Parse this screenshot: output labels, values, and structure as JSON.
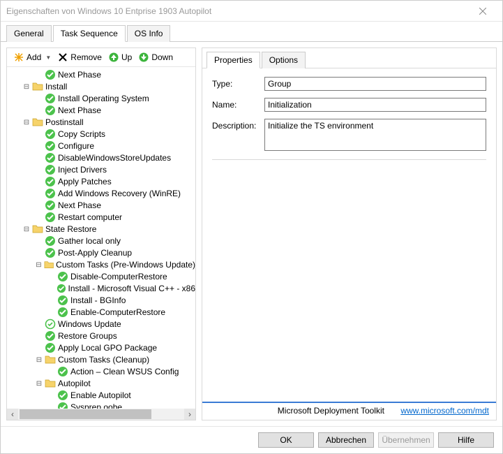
{
  "window": {
    "title": "Eigenschaften von Windows 10 Entprise 1903 Autopilot"
  },
  "main_tabs": {
    "general": "General",
    "task_sequence": "Task Sequence",
    "os_info": "OS Info",
    "active": "task_sequence"
  },
  "toolbar": {
    "add": "Add",
    "remove": "Remove",
    "up": "Up",
    "down": "Down"
  },
  "tree": [
    {
      "icon": "check",
      "label": "Next Phase",
      "depth": 2
    },
    {
      "icon": "folder",
      "label": "Install",
      "depth": 1,
      "expanded": true
    },
    {
      "icon": "check",
      "label": "Install Operating System",
      "depth": 2
    },
    {
      "icon": "check",
      "label": "Next Phase",
      "depth": 2
    },
    {
      "icon": "folder",
      "label": "Postinstall",
      "depth": 1,
      "expanded": true
    },
    {
      "icon": "check",
      "label": "Copy Scripts",
      "depth": 2
    },
    {
      "icon": "check",
      "label": "Configure",
      "depth": 2
    },
    {
      "icon": "check",
      "label": "DisableWindowsStoreUpdates",
      "depth": 2
    },
    {
      "icon": "check",
      "label": "Inject Drivers",
      "depth": 2
    },
    {
      "icon": "check",
      "label": "Apply Patches",
      "depth": 2
    },
    {
      "icon": "check",
      "label": "Add Windows Recovery (WinRE)",
      "depth": 2
    },
    {
      "icon": "check",
      "label": "Next Phase",
      "depth": 2
    },
    {
      "icon": "check",
      "label": "Restart computer",
      "depth": 2
    },
    {
      "icon": "folder",
      "label": "State Restore",
      "depth": 1,
      "expanded": true
    },
    {
      "icon": "check",
      "label": "Gather local only",
      "depth": 2
    },
    {
      "icon": "check",
      "label": "Post-Apply Cleanup",
      "depth": 2
    },
    {
      "icon": "folder",
      "label": "Custom Tasks (Pre-Windows Update)",
      "depth": 2,
      "expanded": true
    },
    {
      "icon": "check",
      "label": "Disable-ComputerRestore",
      "depth": 3
    },
    {
      "icon": "check",
      "label": "Install - Microsoft Visual C++ - x86",
      "depth": 3
    },
    {
      "icon": "check",
      "label": "Install - BGInfo",
      "depth": 3
    },
    {
      "icon": "check",
      "label": "Enable-ComputerRestore",
      "depth": 3
    },
    {
      "icon": "circle",
      "label": "Windows Update",
      "depth": 2
    },
    {
      "icon": "check",
      "label": "Restore Groups",
      "depth": 2
    },
    {
      "icon": "check",
      "label": "Apply Local GPO Package",
      "depth": 2
    },
    {
      "icon": "folder",
      "label": "Custom Tasks (Cleanup)",
      "depth": 2,
      "expanded": true
    },
    {
      "icon": "check",
      "label": "Action – Clean WSUS Config",
      "depth": 3
    },
    {
      "icon": "folder",
      "label": "Autopilot",
      "depth": 2,
      "expanded": true
    },
    {
      "icon": "check",
      "label": "Enable Autopilot",
      "depth": 3
    },
    {
      "icon": "check",
      "label": "Sysprep oobe",
      "depth": 3
    }
  ],
  "right_tabs": {
    "properties": "Properties",
    "options": "Options",
    "active": "properties"
  },
  "properties": {
    "type_label": "Type:",
    "type_value": "Group",
    "name_label": "Name:",
    "name_value": "Initialization",
    "desc_label": "Description:",
    "desc_value": "Initialize the TS environment"
  },
  "footer": {
    "text": "Microsoft Deployment Toolkit",
    "link_text": "www.microsoft.com/mdt"
  },
  "buttons": {
    "ok": "OK",
    "cancel": "Abbrechen",
    "apply": "Übernehmen",
    "help": "Hilfe"
  }
}
